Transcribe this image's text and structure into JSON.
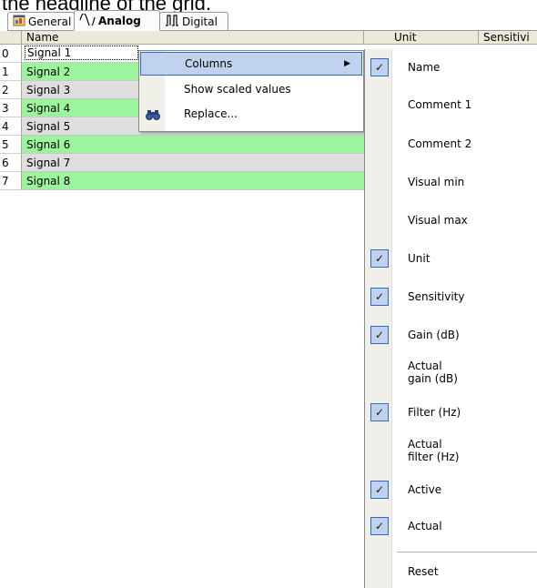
{
  "caption": "the headline of the grid.",
  "tabs": [
    {
      "label": "General",
      "icon": "general-icon"
    },
    {
      "label": "Analog",
      "icon": "analog-wave-icon"
    },
    {
      "label": "Digital",
      "icon": "digital-pulse-icon"
    }
  ],
  "grid": {
    "headers": {
      "name": "Name",
      "unit": "Unit",
      "sensitivity": "Sensitivi"
    },
    "rows": [
      {
        "index": "0",
        "name": "Signal 1"
      },
      {
        "index": "1",
        "name": "Signal 2"
      },
      {
        "index": "2",
        "name": "Signal 3"
      },
      {
        "index": "3",
        "name": "Signal 4"
      },
      {
        "index": "4",
        "name": "Signal 5"
      },
      {
        "index": "5",
        "name": "Signal 6"
      },
      {
        "index": "6",
        "name": "Signal 7"
      },
      {
        "index": "7",
        "name": "Signal 8"
      }
    ]
  },
  "context_menu": {
    "items": [
      {
        "label": "Columns",
        "has_submenu": true
      },
      {
        "label": "Show scaled values"
      },
      {
        "label": "Replace...",
        "icon": "binoculars-icon"
      }
    ]
  },
  "columns_submenu": {
    "items": [
      {
        "label": "Name",
        "checked": true
      },
      {
        "label": "Comment 1",
        "checked": false
      },
      {
        "label": "Comment 2",
        "checked": false
      },
      {
        "label": "Visual min",
        "checked": false
      },
      {
        "label": "Visual max",
        "checked": false
      },
      {
        "label": "Unit",
        "checked": true
      },
      {
        "label": "Sensitivity",
        "checked": true
      },
      {
        "label": "Gain (dB)",
        "checked": true
      },
      {
        "label": "Actual\ngain (dB)",
        "checked": false
      },
      {
        "label": "Filter (Hz)",
        "checked": true
      },
      {
        "label": "Actual\nfilter (Hz)",
        "checked": false
      },
      {
        "label": "Active",
        "checked": true
      },
      {
        "label": "Actual",
        "checked": true
      }
    ],
    "reset_label": "Reset"
  },
  "colors": {
    "row_green": "#9cf59c",
    "row_gray": "#dedede",
    "menu_highlight": "#c1d2ee",
    "menu_border": "#316ac5"
  }
}
